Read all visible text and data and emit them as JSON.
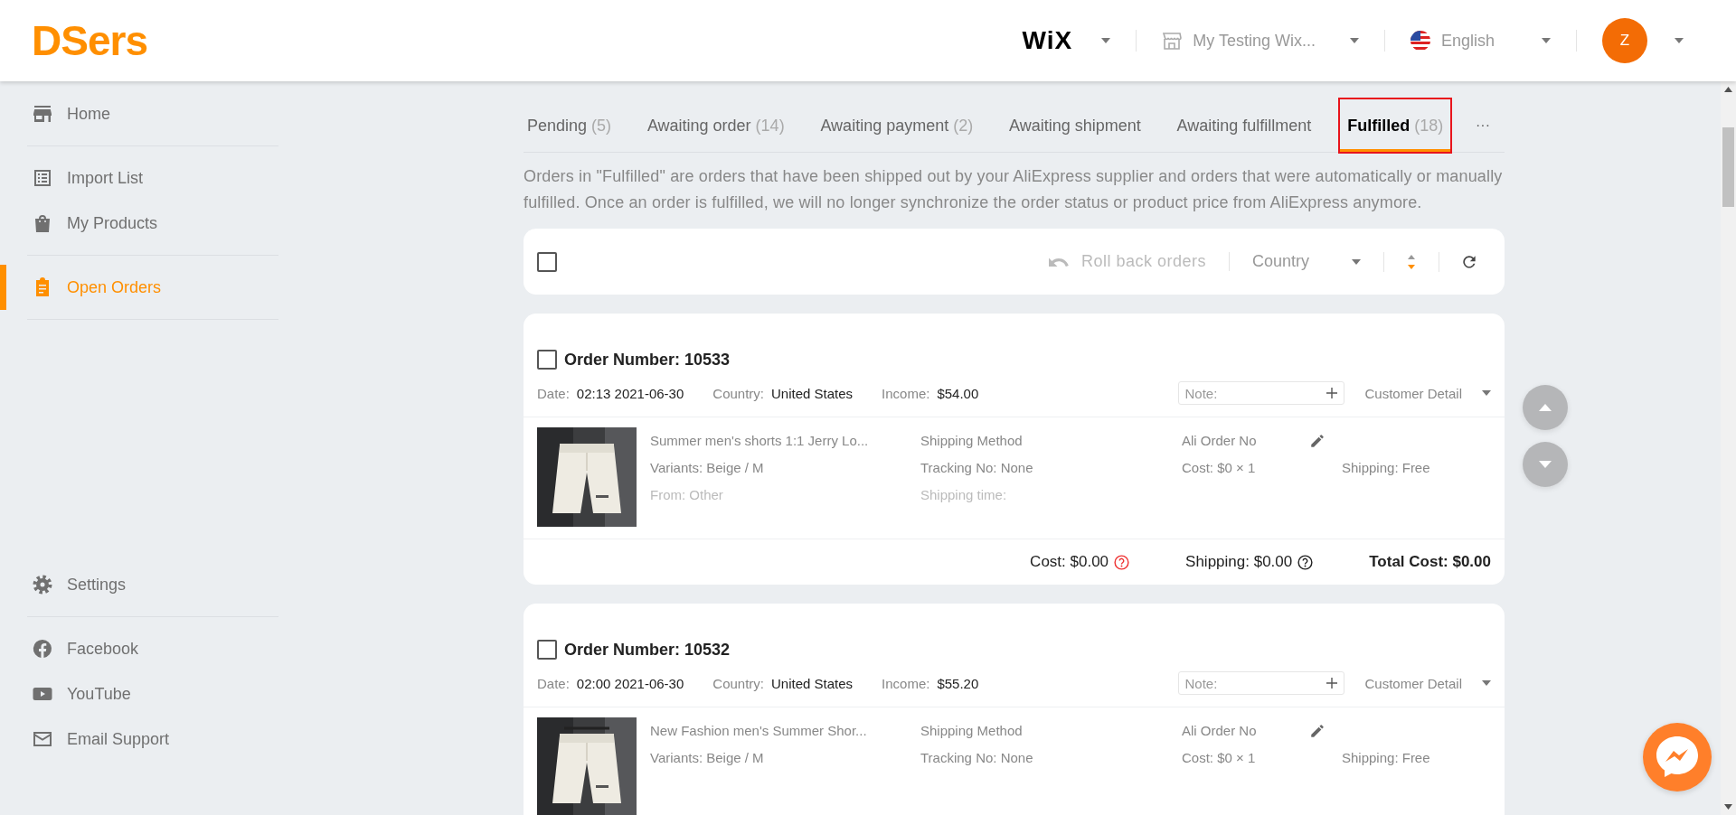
{
  "header": {
    "logo": "DSers",
    "platform": "WiX",
    "store": "My Testing Wix...",
    "language": "English",
    "avatar": "Z"
  },
  "sidebar": {
    "top": [
      {
        "items": [
          {
            "label": "Home",
            "kind": "store",
            "selected": false
          }
        ]
      },
      {
        "items": [
          {
            "label": "Import List",
            "kind": "list",
            "selected": false
          },
          {
            "label": "My Products",
            "kind": "bag",
            "selected": false
          }
        ]
      },
      {
        "items": [
          {
            "label": "Open Orders",
            "kind": "clipboard",
            "selected": true
          }
        ]
      }
    ],
    "bottom": [
      {
        "items": [
          {
            "label": "Settings",
            "kind": "gear",
            "selected": false
          }
        ]
      },
      {
        "items": [
          {
            "label": "Facebook",
            "kind": "facebook",
            "selected": false
          },
          {
            "label": "YouTube",
            "kind": "youtube",
            "selected": false
          },
          {
            "label": "Email Support",
            "kind": "mail",
            "selected": false
          }
        ]
      }
    ]
  },
  "tabs": [
    {
      "label": "Pending",
      "count": "(5)",
      "selected": false
    },
    {
      "label": "Awaiting order",
      "count": "(14)",
      "selected": false
    },
    {
      "label": "Awaiting payment",
      "count": "(2)",
      "selected": false
    },
    {
      "label": "Awaiting shipment",
      "selected": false
    },
    {
      "label": "Awaiting fulfillment",
      "selected": false
    },
    {
      "label": "Fulfilled",
      "count": "(18)",
      "selected": true
    }
  ],
  "tabs_more": "···",
  "description": "Orders in \"Fulfilled\" are orders that have been shipped out by your AliExpress supplier and orders that were automatically or manually fulfilled. Once an order is fulfilled, we will no longer synchronize the order status or product price from AliExpress anymore.",
  "toolbar": {
    "select_all_checked": false,
    "rollback": {
      "label": "Roll back orders",
      "disabled": true
    },
    "country": {
      "placeholder": "Country"
    }
  },
  "orders": [
    {
      "number": "Order Number: 10533",
      "checked": false,
      "date_label": "Date:",
      "date": "02:13 2021-06-30",
      "country_label": "Country:",
      "country": "United States",
      "income_label": "Income:",
      "income": "$54.00",
      "note": {
        "placeholder": "Note:"
      },
      "customer_detail": "Customer Detail",
      "items": [
        {
          "title": "Summer men's shorts 1:1 Jerry Lo...",
          "variants": "Variants: Beige / M",
          "from": "From: Other",
          "shipping_method": "Shipping Method",
          "tracking": "Tracking No: None",
          "shipping_time": "Shipping time:",
          "ali_order": "Ali Order No",
          "cost": "Cost: $0 × 1",
          "shipping": "Shipping: Free"
        }
      ],
      "totals": {
        "cost": "Cost: $0.00",
        "shipping": "Shipping: $0.00",
        "total": "Total Cost: $0.00"
      }
    },
    {
      "number": "Order Number: 10532",
      "checked": false,
      "date_label": "Date:",
      "date": "02:00 2021-06-30",
      "country_label": "Country:",
      "country": "United States",
      "income_label": "Income:",
      "income": "$55.20",
      "note": {
        "placeholder": "Note:"
      },
      "customer_detail": "Customer Detail",
      "items": [
        {
          "title": "New Fashion men's Summer Shor...",
          "variants": "Variants: Beige / M",
          "shipping_method": "Shipping Method",
          "tracking": "Tracking No: None",
          "ali_order": "Ali Order No",
          "cost": "Cost: $0 × 1",
          "shipping": "Shipping: Free"
        }
      ]
    }
  ]
}
